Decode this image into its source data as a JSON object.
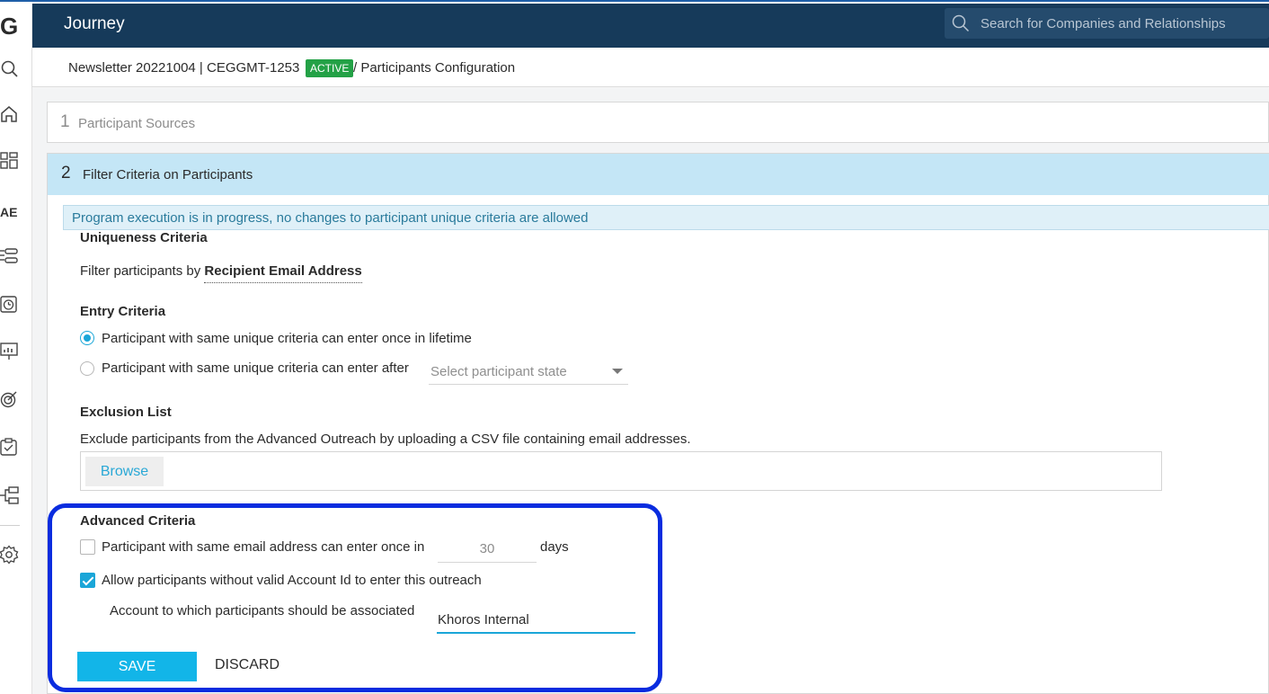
{
  "app": {
    "logo": "G",
    "title": "Journey"
  },
  "search": {
    "placeholder": "Search for Companies and Relationships"
  },
  "rail": {
    "icons": [
      "search-icon",
      "home-icon",
      "dashboard-icon",
      "ae-label",
      "list-icon",
      "timer-icon",
      "report-icon",
      "target-icon",
      "clipboard-icon",
      "hierarchy-icon",
      "gear-icon"
    ],
    "ae_label": "AE"
  },
  "breadcrumb": {
    "program": "Newsletter 20221004 | CEGGMT-1253",
    "status": "ACTIVE",
    "page": "/ Participants Configuration"
  },
  "steps": [
    {
      "number": "1",
      "label": "Participant Sources"
    },
    {
      "number": "2",
      "label": "Filter Criteria on Participants"
    }
  ],
  "notice": "Program execution is in progress, no changes to participant unique criteria are allowed",
  "uniqueness": {
    "heading": "Uniqueness Criteria",
    "text": "Filter participants by",
    "field": "Recipient Email Address"
  },
  "entry": {
    "heading": "Entry Criteria",
    "option1": "Participant with same unique criteria can enter once in lifetime",
    "option2": "Participant with same unique criteria can enter after",
    "select_placeholder": "Select participant state",
    "selected": "option1"
  },
  "exclusion": {
    "heading": "Exclusion List",
    "text": "Exclude participants from the Advanced Outreach by uploading a CSV file containing email addresses.",
    "browse_label": "Browse"
  },
  "advanced": {
    "heading": "Advanced Criteria",
    "email_once_label": "Participant with same email address can enter once in",
    "email_once_checked": false,
    "days_value": "30",
    "days_label": "days",
    "allow_label": "Allow participants without valid Account Id to enter this outreach",
    "allow_checked": true,
    "account_label": "Account to which participants should be associated",
    "account_value": "Khoros Internal"
  },
  "actions": {
    "save": "SAVE",
    "discard": "DISCARD"
  },
  "colors": {
    "header": "#163a5a",
    "accent": "#12b5e8",
    "active_badge": "#23a146",
    "highlight": "#0a2cdf"
  }
}
